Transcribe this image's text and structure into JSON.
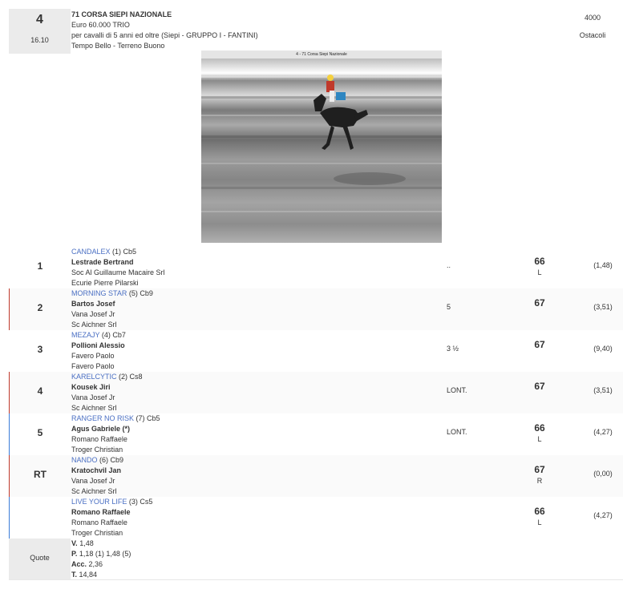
{
  "race": {
    "number": "4",
    "time": "16.10",
    "title": "71 CORSA SIEPI NAZIONALE",
    "prize": "Euro 60.000 TRIO",
    "conditions": "per cavalli di 5 anni ed oltre (Siepi -  GRUPPO I  - FANTINI)",
    "weather": "Tempo Bello - Terreno Buono",
    "distance": "4000",
    "surface": "Ostacoli"
  },
  "video": {
    "caption": "4 - 71 Corsa Siepi Nazionale"
  },
  "runners": [
    {
      "pos": "1",
      "horse": "CANDALEX",
      "stall": "(1)",
      "code": "Cb5",
      "jockey": "Lestrade Bertrand",
      "owner": "Soc Al Guillaume Macaire Srl",
      "trainer": "Ecurie Pierre Pilarski",
      "gap": "..",
      "weight": "66",
      "note": "L",
      "odds": "(1,48)",
      "marker": ""
    },
    {
      "pos": "2",
      "horse": "MORNING STAR",
      "stall": "(5)",
      "code": "Cb9",
      "jockey": "Bartos Josef",
      "owner": "Vana Josef Jr",
      "trainer": "Sc Aichner Srl",
      "gap": "5",
      "weight": "67",
      "note": "",
      "odds": "(3,51)",
      "marker": "#c0392b"
    },
    {
      "pos": "3",
      "horse": "MEZAJY",
      "stall": "(4)",
      "code": "Cb7",
      "jockey": "Pollioni Alessio",
      "owner": "Favero Paolo",
      "trainer": "Favero Paolo",
      "gap": "3 ½",
      "weight": "67",
      "note": "",
      "odds": "(9,40)",
      "marker": ""
    },
    {
      "pos": "4",
      "horse": "KARELCYTIC",
      "stall": "(2)",
      "code": "Cs8",
      "jockey": "Kousek Jiri",
      "owner": "Vana Josef Jr",
      "trainer": "Sc Aichner Srl",
      "gap": "LONT.",
      "weight": "67",
      "note": "",
      "odds": "(3,51)",
      "marker": "#c0392b"
    },
    {
      "pos": "5",
      "horse": "RANGER NO RISK",
      "stall": "(7)",
      "code": "Cb5",
      "jockey": "Agus Gabriele (*)",
      "owner": "Romano Raffaele",
      "trainer": "Troger Christian",
      "gap": "LONT.",
      "weight": "66",
      "note": "L",
      "odds": "(4,27)",
      "marker": "#3b7dd8"
    },
    {
      "pos": "RT",
      "horse": "NANDO",
      "stall": "(6)",
      "code": "Cb9",
      "jockey": "Kratochvil Jan",
      "owner": "Vana Josef Jr",
      "trainer": "Sc Aichner Srl",
      "gap": "",
      "weight": "67",
      "note": "R",
      "odds": "(0,00)",
      "marker": "#c0392b"
    },
    {
      "pos": "",
      "horse": "LIVE YOUR LIFE",
      "stall": "(3)",
      "code": "Cs5",
      "jockey": "Romano Raffaele",
      "owner": "Romano Raffaele",
      "trainer": "Troger Christian",
      "gap": "",
      "weight": "66",
      "note": "L",
      "odds": "(4,27)",
      "marker": "#3b7dd8"
    }
  ],
  "quote": {
    "label": "Quote",
    "lines": [
      {
        "key": "V.",
        "value": " 1,48"
      },
      {
        "key": "P.",
        "value": " 1,18 (1)  1,48 (5)"
      },
      {
        "key": "Acc.",
        "value": " 2,36"
      },
      {
        "key": "T.",
        "value": " 14,84"
      }
    ]
  }
}
